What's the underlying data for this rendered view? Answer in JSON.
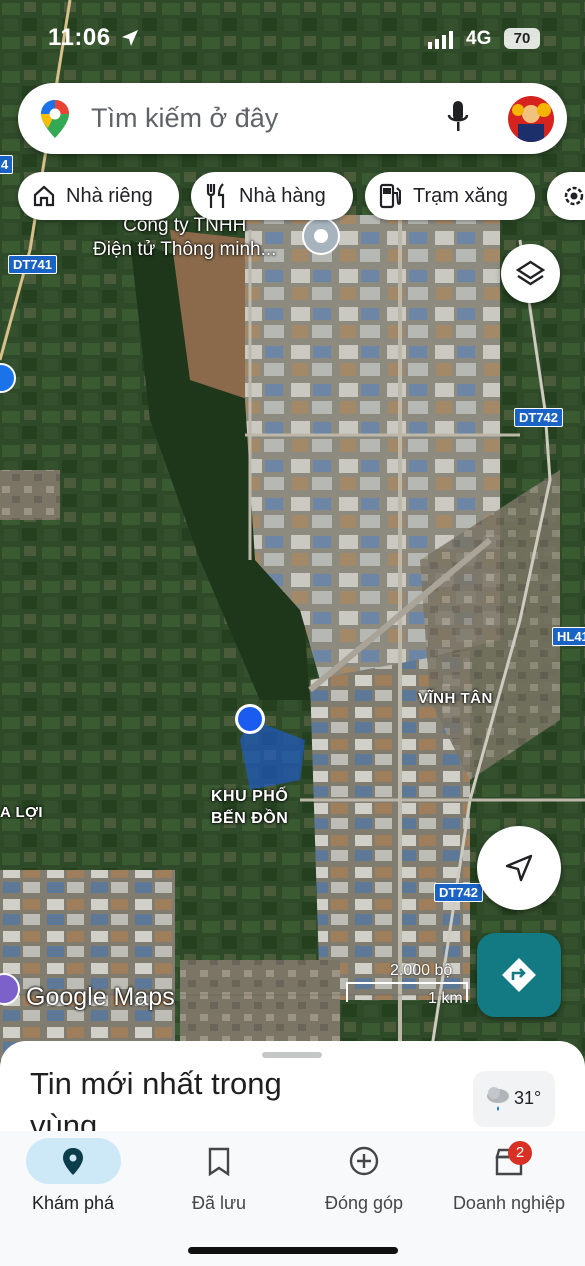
{
  "status_bar": {
    "time": "11:06",
    "network": "4G",
    "battery": "70"
  },
  "search": {
    "placeholder": "Tìm kiếm ở đây"
  },
  "chips": [
    {
      "label": "Nhà riêng",
      "icon": "home-icon"
    },
    {
      "label": "Nhà hàng",
      "icon": "restaurant-icon"
    },
    {
      "label": "Trạm xăng",
      "icon": "gas-station-icon"
    },
    {
      "label": "",
      "icon": "gear-icon"
    }
  ],
  "map": {
    "roads": [
      "DT741",
      "DT742",
      "DT742",
      "HL41",
      "DT742",
      "4"
    ],
    "places": [
      "VĨNH TÂN",
      "KHU PHỐ\nBẾN ĐỒN",
      "A LỢI"
    ],
    "business": "Công ty TNHH\nĐiện tử Thông minh...",
    "logo": "Google Maps",
    "scale_top": "2.000 bộ",
    "scale_bottom": "1 km"
  },
  "sheet": {
    "title": "Tin mới nhất trong vùng...",
    "temperature": "31°"
  },
  "nav": [
    {
      "label": "Khám phá",
      "icon": "explore-pin-icon",
      "active": true
    },
    {
      "label": "Đã lưu",
      "icon": "bookmark-icon"
    },
    {
      "label": "Đóng góp",
      "icon": "add-circle-icon"
    },
    {
      "label": "Doanh nghiệp",
      "icon": "business-icon",
      "badge": "2"
    }
  ],
  "colors": {
    "accent": "#137a84",
    "location_blue": "#1a5cf0",
    "nav_pill": "#cde8f6"
  }
}
